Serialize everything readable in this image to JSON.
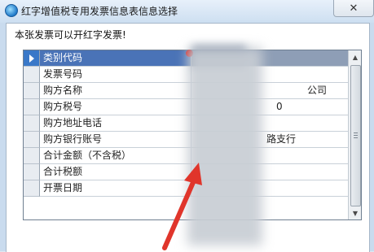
{
  "window": {
    "title": "红字增值税专用发票信息表信息选择",
    "close_glyph": "✕"
  },
  "message": "本张发票可以开红字发票!",
  "grid": {
    "rows": [
      {
        "label": "类别代码",
        "value": "",
        "visible_tail": "",
        "selected": true
      },
      {
        "label": "发票号码",
        "value": "",
        "visible_tail": ""
      },
      {
        "label": "购方名称",
        "value": "",
        "visible_tail": "公司"
      },
      {
        "label": "购方税号",
        "value": "",
        "visible_tail": "0"
      },
      {
        "label": "购方地址电话",
        "value": "",
        "visible_tail": ""
      },
      {
        "label": "购方银行账号",
        "value": "",
        "visible_tail": "路支行"
      },
      {
        "label": "合计金额（不含税）",
        "value": "",
        "visible_tail": ""
      },
      {
        "label": "合计税额",
        "value": "",
        "visible_tail": ""
      },
      {
        "label": "开票日期",
        "value": "",
        "visible_tail": ""
      }
    ]
  },
  "colors": {
    "selection_label": "#4a73b7",
    "selection_value": "#8e9eb6",
    "annotation_arrow": "#e0352b",
    "error_dot": "#d82020"
  },
  "icons": [
    "app-icon",
    "close-icon",
    "row-pointer-icon",
    "scroll-up-icon",
    "scroll-down-icon",
    "error-indicator-icon"
  ]
}
